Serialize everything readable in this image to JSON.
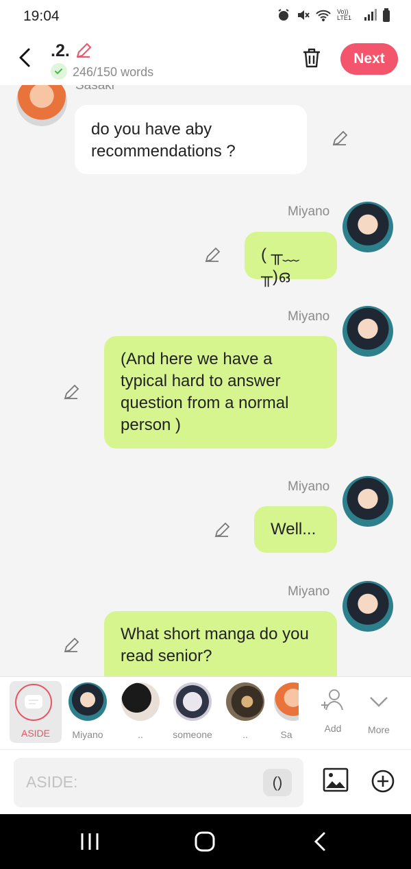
{
  "status": {
    "time": "19:04",
    "network": "Vo)) LTE1"
  },
  "header": {
    "title": ".2.",
    "word_count": "246/150 words",
    "next_label": "Next"
  },
  "messages": [
    {
      "side": "left",
      "name": "Sasaki",
      "text": "do you have aby recommendations ?"
    },
    {
      "side": "right",
      "name": "Miyano",
      "text": "( ╥﹏╥)ഒ"
    },
    {
      "side": "right",
      "name": "Miyano",
      "text": "(And here we have a typical hard to answer question from a normal person )"
    },
    {
      "side": "right",
      "name": "Miyano",
      "text": "Well..."
    },
    {
      "side": "right",
      "name": "Miyano",
      "text": "What short manga do you read senior?"
    }
  ],
  "characters": [
    {
      "label": "ASIDE"
    },
    {
      "label": "Miyano"
    },
    {
      "label": ".."
    },
    {
      "label": "someone"
    },
    {
      "label": ".."
    },
    {
      "label": "Sa"
    },
    {
      "label": "Add"
    },
    {
      "label": "More"
    }
  ],
  "input": {
    "placeholder": "ASIDE:",
    "paren_label": "()"
  },
  "colors": {
    "accent": "#f2556c",
    "bubble_right": "#d6f58f",
    "bubble_left": "#ffffff"
  }
}
